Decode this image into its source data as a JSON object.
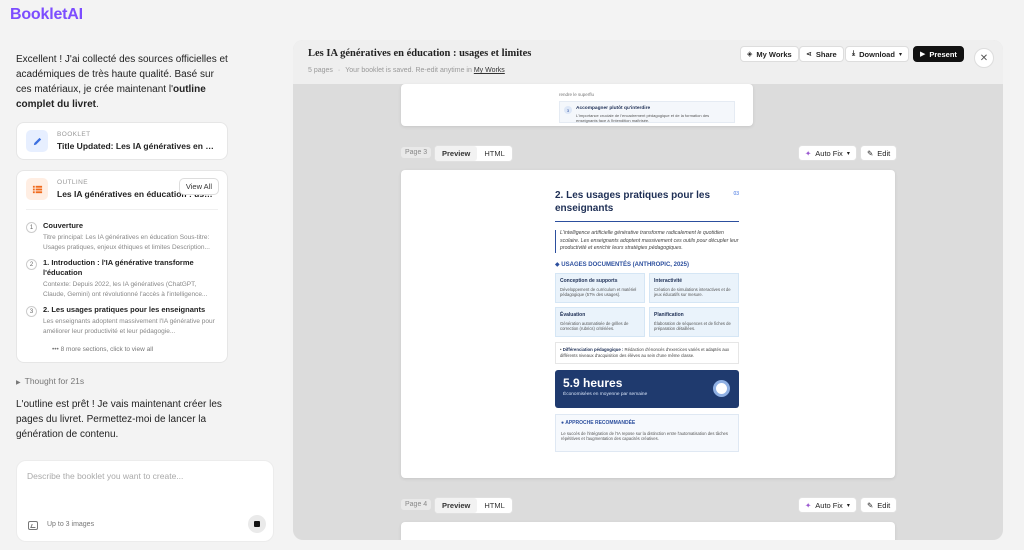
{
  "app": {
    "name": "BookletAI"
  },
  "chat": {
    "intro_plain": "Excellent ! J'ai collecté des sources officielles et académiques de très haute qualité. Basé sur ces matériaux, je crée maintenant l'",
    "intro_bold": "outline complet du livret",
    "intro_end": ".",
    "booklet_card": {
      "kicker": "BOOKLET",
      "title": "Title Updated: Les IA génératives en éducation : usages et limites"
    },
    "outline_card": {
      "kicker": "OUTLINE",
      "title": "Les IA génératives en éducation : usages et limites",
      "view_all": "View All",
      "items": [
        {
          "num": "1",
          "title": "Couverture",
          "desc": "Titre principal: Les IA génératives en éducation Sous-titre: Usages pratiques, enjeux éthiques et limites Description..."
        },
        {
          "num": "2",
          "title": "1. Introduction : l'IA générative transforme l'éducation",
          "desc": "Contexte: Depuis 2022, les IA génératives (ChatGPT, Claude, Gemini) ont révolutionné l'accès à l'intelligence..."
        },
        {
          "num": "3",
          "title": "2. Les usages pratiques pour les enseignants",
          "desc": "Les enseignants adoptent massivement l'IA générative pour améliorer leur productivité et leur pédagogie..."
        }
      ],
      "more": "••• 8 more sections, click to view all"
    },
    "thought": "Thought for 21s",
    "msg2": "L'outline est prêt ! Je vais maintenant créer les pages du livret. Permettez-moi de lancer la génération de contenu.",
    "composer": {
      "placeholder": "Describe the booklet you want to create...",
      "images_hint": "Up to 3 images"
    }
  },
  "preview": {
    "title": "Les IA génératives en éducation : usages et limites",
    "pages_count": "5 pages",
    "saved_text": "Your booklet is saved. Re-edit anytime in",
    "saved_link": "My Works",
    "buttons": {
      "my_works": "My Works",
      "share": "Share",
      "download": "Download",
      "present": "Present"
    },
    "page2": {
      "top_line": "rendre le superflu",
      "step_num": "3",
      "step_title": "Accompagner plutôt qu'interdire",
      "step_desc": "L'importance cruciale de l'encadrement pédagogique et de la formation des enseignants face à l'intendition maîtrisée."
    },
    "page3": {
      "label": "Page 3",
      "tab_preview": "Preview",
      "tab_html": "HTML",
      "autofix": "Auto Fix",
      "edit": "Edit",
      "doc": {
        "page_num": "03",
        "heading": "2. Les usages pratiques pour les enseignants",
        "quote": "L'intelligence artificielle générative transforme radicalement le quotidien scolaire. Les enseignants adoptent massivement ces outils pour décupler leur productivité et enrichir leurs stratégies pédagogiques.",
        "section": "USAGES DOCUMENTÉS (ANTHROPIC, 2025)",
        "cells": [
          {
            "title": "Conception de supports",
            "desc": "Développement de curriculum et matériel pédagogique (57% des usages)."
          },
          {
            "title": "Interactivité",
            "desc": "Création de simulations interactives et de jeux éducatifs sur mesure."
          },
          {
            "title": "Évaluation",
            "desc": "Génération automatisée de grilles de correction (rubrics) critériées."
          },
          {
            "title": "Planification",
            "desc": "Élaboration de séquences et de fiches de préparation détaillées."
          }
        ],
        "diff_label": "Différenciation pédagogique :",
        "diff_text": "Rédaction d'énoncés d'exercices variés et adaptés aux différents niveaux d'acquisition des élèves au sein d'une même classe.",
        "stat_value": "5.9 heures",
        "stat_label": "Économisées en moyenne par semaine",
        "approach_title": "APPROCHE RECOMMANDÉE",
        "approach_desc": "Le succès de l'intégration de l'IA repose sur la distinction entre l'automatisation des tâches répétitives et l'augmentation des capacités créatives."
      }
    },
    "page4": {
      "label": "Page 4",
      "tab_preview": "Preview",
      "tab_html": "HTML",
      "autofix": "Auto Fix",
      "edit": "Edit"
    }
  },
  "colors": {
    "brand": "#7c4dff",
    "doc_blue": "#1f3a6e",
    "accent_blue": "#2c4f9e"
  }
}
